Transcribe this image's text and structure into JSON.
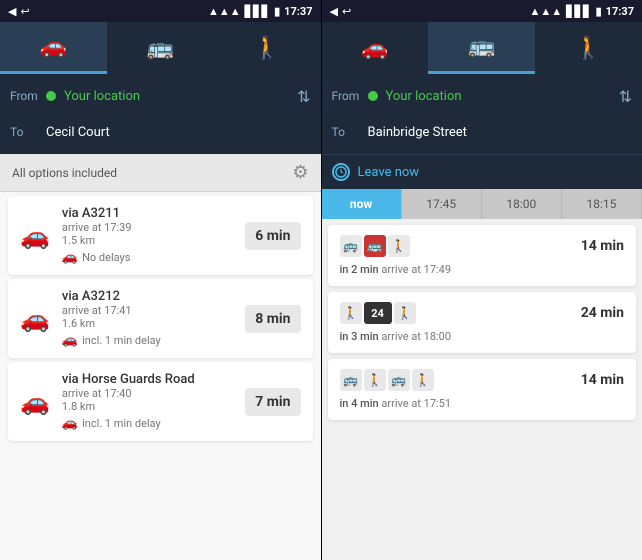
{
  "left_panel": {
    "status_bar": {
      "time": "17:37",
      "signal": "▲▲▲",
      "battery": "🔋"
    },
    "nav_tabs": [
      {
        "id": "car",
        "icon": "🚗",
        "active": true
      },
      {
        "id": "bus",
        "icon": "🚌",
        "active": false
      },
      {
        "id": "walk",
        "icon": "🚶",
        "active": false
      }
    ],
    "from_label": "From",
    "from_dot_color": "#44cc44",
    "from_location": "Your location",
    "to_label": "To",
    "to_location": "Cecil Court",
    "swap_icon": "⇅",
    "options_text": "All options included",
    "gear_symbol": "⚙",
    "routes": [
      {
        "via": "via A3211",
        "arrive": "arrive at 17:39",
        "dist": "1.5 km",
        "delay": "No delays",
        "delay_icon": "🚗",
        "time": "6 min",
        "has_delay": false
      },
      {
        "via": "via A3212",
        "arrive": "arrive at 17:41",
        "dist": "1.6 km",
        "delay": "incl. 1 min delay",
        "delay_icon": "🚗",
        "time": "8 min",
        "has_delay": true
      },
      {
        "via": "via Horse Guards Road",
        "arrive": "arrive at 17:40",
        "dist": "1.8 km",
        "delay": "incl. 1 min delay",
        "delay_icon": "🚗",
        "time": "7 min",
        "has_delay": true
      }
    ]
  },
  "right_panel": {
    "status_bar": {
      "time": "17:37"
    },
    "nav_tabs": [
      {
        "id": "car",
        "icon": "🚗",
        "active": false
      },
      {
        "id": "bus",
        "icon": "🚌",
        "active": true
      },
      {
        "id": "walk",
        "icon": "🚶",
        "active": false
      }
    ],
    "from_label": "From",
    "from_location": "Your location",
    "to_label": "To",
    "to_location": "Bainbridge Street",
    "swap_icon": "⇅",
    "leave_now_label": "Leave now",
    "time_tabs": [
      {
        "label": "now",
        "active": true
      },
      {
        "label": "17:45",
        "active": false
      },
      {
        "label": "18:00",
        "active": false
      },
      {
        "label": "18:15",
        "active": false
      }
    ],
    "transits": [
      {
        "icons": [
          "bus",
          "bus-red",
          "walk"
        ],
        "time_badge": "14 min",
        "in_min": "in 2 min",
        "arrive": "arrive at 17:49"
      },
      {
        "icons": [
          "walk",
          "num24",
          "walk"
        ],
        "num": "24",
        "time_badge": "24 min",
        "in_min": "in 3 min",
        "arrive": "arrive at 18:00"
      },
      {
        "icons": [
          "bus",
          "walk",
          "bus",
          "walk"
        ],
        "time_badge": "14 min",
        "in_min": "in 4 min",
        "arrive": "arrive at 17:51"
      }
    ]
  }
}
